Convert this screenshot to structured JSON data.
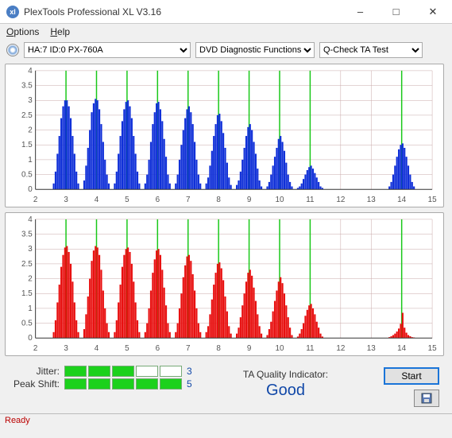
{
  "window": {
    "title": "PlexTools Professional XL V3.16"
  },
  "menu": {
    "options": "Options",
    "help": "Help"
  },
  "toolbar": {
    "drive": "HA:7 ID:0   PX-760A",
    "func": "DVD Diagnostic Functions",
    "test": "Q-Check TA Test"
  },
  "chart_data": [
    {
      "type": "bar",
      "color": "#1030d8",
      "x_ticks": [
        2,
        3,
        4,
        5,
        6,
        7,
        8,
        9,
        10,
        11,
        12,
        13,
        14,
        15
      ],
      "y_ticks": [
        0,
        0.5,
        1,
        1.5,
        2,
        2.5,
        3,
        3.5,
        4
      ],
      "ylim": [
        0,
        4
      ],
      "green_lines": [
        3,
        4,
        5,
        6,
        7,
        8,
        9,
        10,
        11,
        14
      ],
      "clusters": [
        {
          "center": 3,
          "values": [
            0.2,
            0.6,
            1.2,
            1.8,
            2.4,
            2.8,
            3.0,
            3.0,
            2.8,
            2.4,
            1.8,
            1.2,
            0.6,
            0.2
          ]
        },
        {
          "center": 4,
          "values": [
            0.3,
            0.8,
            1.4,
            2.0,
            2.6,
            2.9,
            3.05,
            3.0,
            2.7,
            2.2,
            1.6,
            1.0,
            0.5,
            0.2
          ]
        },
        {
          "center": 5,
          "values": [
            0.2,
            0.6,
            1.2,
            1.8,
            2.3,
            2.7,
            2.95,
            3.0,
            2.8,
            2.4,
            1.8,
            1.2,
            0.6,
            0.2
          ]
        },
        {
          "center": 6,
          "values": [
            0.2,
            0.5,
            1.0,
            1.6,
            2.2,
            2.6,
            2.9,
            2.95,
            2.7,
            2.3,
            1.7,
            1.1,
            0.5,
            0.2
          ]
        },
        {
          "center": 7,
          "values": [
            0.2,
            0.5,
            1.0,
            1.5,
            2.0,
            2.4,
            2.7,
            2.8,
            2.6,
            2.2,
            1.6,
            1.0,
            0.5,
            0.2
          ]
        },
        {
          "center": 8,
          "values": [
            0.2,
            0.4,
            0.8,
            1.3,
            1.8,
            2.2,
            2.5,
            2.55,
            2.3,
            1.9,
            1.4,
            0.9,
            0.4,
            0.15
          ]
        },
        {
          "center": 9,
          "values": [
            0.15,
            0.3,
            0.6,
            1.0,
            1.4,
            1.8,
            2.1,
            2.2,
            2.0,
            1.6,
            1.2,
            0.7,
            0.3,
            0.1
          ]
        },
        {
          "center": 10,
          "values": [
            0.1,
            0.25,
            0.5,
            0.8,
            1.1,
            1.4,
            1.7,
            1.8,
            1.6,
            1.3,
            0.9,
            0.5,
            0.25,
            0.1
          ]
        },
        {
          "center": 11,
          "values": [
            0.05,
            0.1,
            0.2,
            0.35,
            0.5,
            0.65,
            0.75,
            0.8,
            0.7,
            0.55,
            0.4,
            0.25,
            0.1,
            0.05
          ]
        },
        {
          "center": 14,
          "values": [
            0.1,
            0.25,
            0.5,
            0.8,
            1.1,
            1.35,
            1.5,
            1.55,
            1.4,
            1.1,
            0.8,
            0.5,
            0.25,
            0.1
          ]
        }
      ]
    },
    {
      "type": "bar",
      "color": "#e81010",
      "x_ticks": [
        2,
        3,
        4,
        5,
        6,
        7,
        8,
        9,
        10,
        11,
        12,
        13,
        14,
        15
      ],
      "y_ticks": [
        0,
        0.5,
        1,
        1.5,
        2,
        2.5,
        3,
        3.5,
        4
      ],
      "ylim": [
        0,
        4
      ],
      "green_lines": [
        3,
        4,
        5,
        6,
        7,
        8,
        9,
        10,
        11,
        14
      ],
      "clusters": [
        {
          "center": 3,
          "values": [
            0.2,
            0.6,
            1.2,
            1.8,
            2.4,
            2.8,
            3.05,
            3.1,
            2.9,
            2.5,
            1.9,
            1.2,
            0.6,
            0.2
          ]
        },
        {
          "center": 4,
          "values": [
            0.3,
            0.8,
            1.4,
            2.0,
            2.6,
            2.95,
            3.1,
            3.05,
            2.8,
            2.3,
            1.6,
            1.0,
            0.5,
            0.2
          ]
        },
        {
          "center": 5,
          "values": [
            0.2,
            0.6,
            1.2,
            1.8,
            2.4,
            2.8,
            3.0,
            3.05,
            2.9,
            2.5,
            1.9,
            1.2,
            0.6,
            0.2
          ]
        },
        {
          "center": 6,
          "values": [
            0.2,
            0.5,
            1.0,
            1.6,
            2.2,
            2.65,
            2.95,
            3.0,
            2.8,
            2.3,
            1.7,
            1.1,
            0.5,
            0.2
          ]
        },
        {
          "center": 7,
          "values": [
            0.2,
            0.5,
            1.0,
            1.5,
            2.05,
            2.45,
            2.75,
            2.8,
            2.6,
            2.15,
            1.6,
            1.0,
            0.5,
            0.2
          ]
        },
        {
          "center": 8,
          "values": [
            0.2,
            0.4,
            0.8,
            1.3,
            1.8,
            2.2,
            2.5,
            2.55,
            2.35,
            1.95,
            1.4,
            0.9,
            0.4,
            0.15
          ]
        },
        {
          "center": 9,
          "values": [
            0.15,
            0.35,
            0.7,
            1.1,
            1.5,
            1.9,
            2.2,
            2.3,
            2.1,
            1.7,
            1.25,
            0.8,
            0.4,
            0.15
          ]
        },
        {
          "center": 10,
          "values": [
            0.1,
            0.3,
            0.55,
            0.9,
            1.25,
            1.6,
            1.9,
            2.05,
            1.85,
            1.5,
            1.1,
            0.7,
            0.35,
            0.1
          ]
        },
        {
          "center": 11,
          "values": [
            0.05,
            0.15,
            0.3,
            0.5,
            0.75,
            0.95,
            1.1,
            1.15,
            1.0,
            0.8,
            0.55,
            0.35,
            0.15,
            0.05
          ]
        },
        {
          "center": 14,
          "values": [
            0.03,
            0.06,
            0.1,
            0.15,
            0.22,
            0.32,
            0.48,
            0.85,
            0.35,
            0.18,
            0.1,
            0.06,
            0.03,
            0.02
          ]
        }
      ]
    }
  ],
  "metrics": {
    "jitter_label": "Jitter:",
    "jitter_value": "3",
    "jitter_fill": 3,
    "peak_label": "Peak Shift:",
    "peak_value": "5",
    "peak_fill": 5
  },
  "ta": {
    "label": "TA Quality Indicator:",
    "value": "Good"
  },
  "buttons": {
    "start": "Start"
  },
  "status": "Ready"
}
